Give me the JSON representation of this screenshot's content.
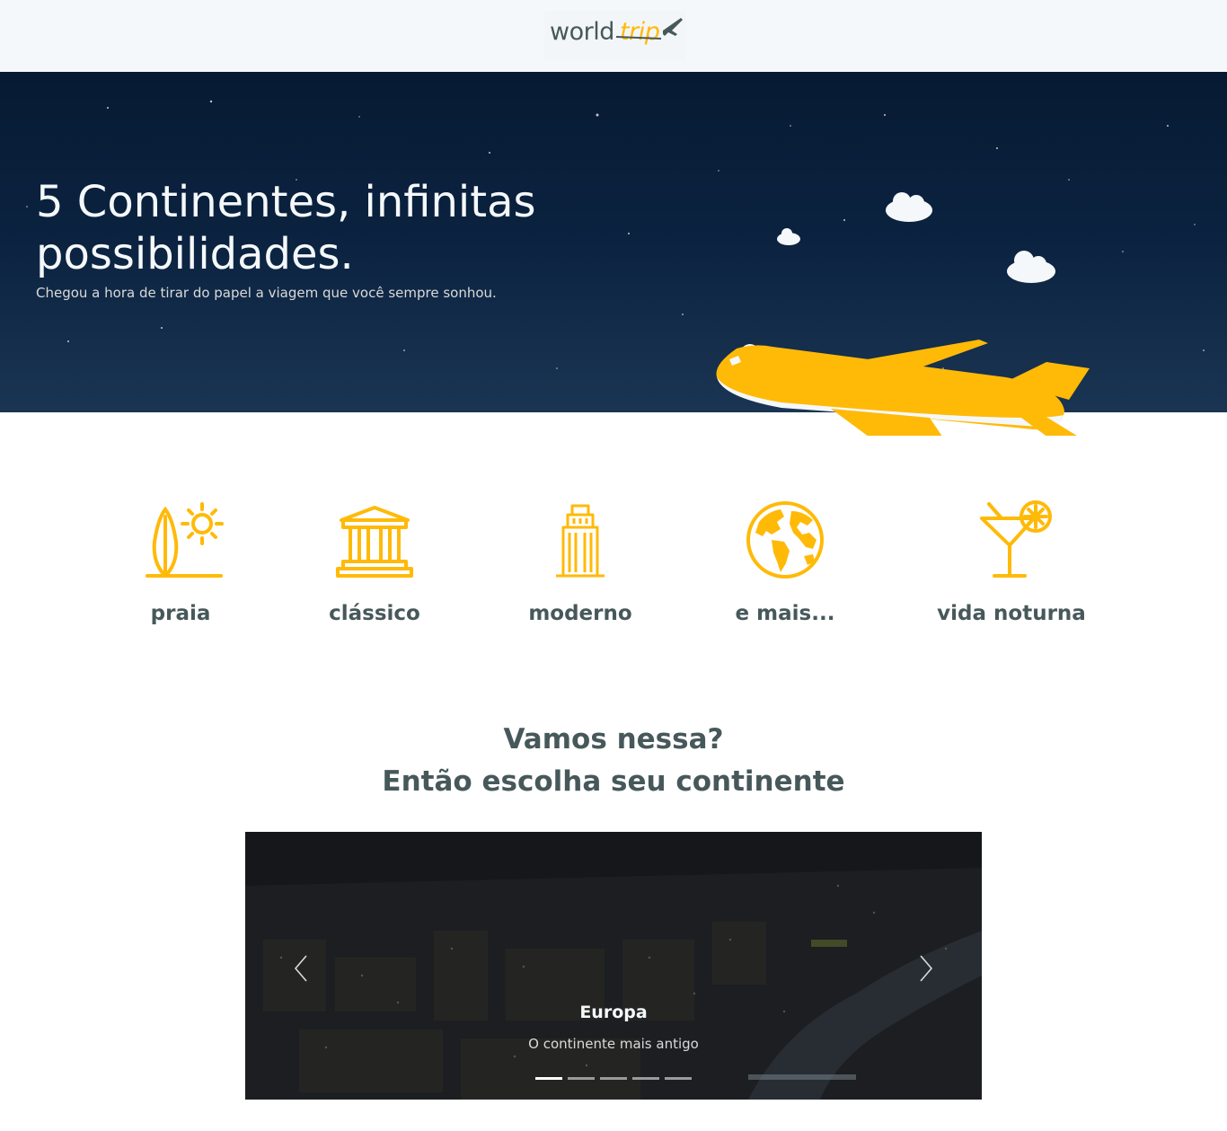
{
  "header": {
    "logo_world": "world",
    "logo_trip": "trip"
  },
  "hero": {
    "title": "5 Continentes, infinitas possibilidades.",
    "subtitle": "Chegou a hora de tirar do papel a viagem que você sempre sonhou."
  },
  "categories": [
    {
      "label": "praia",
      "icon": "surfboard-sun-icon"
    },
    {
      "label": "clássico",
      "icon": "museum-icon"
    },
    {
      "label": "moderno",
      "icon": "skyscraper-icon"
    },
    {
      "label": "e mais...",
      "icon": "globe-icon"
    },
    {
      "label": "vida noturna",
      "icon": "cocktail-icon"
    }
  ],
  "section": {
    "line1": "Vamos nessa?",
    "line2": "Então escolha seu continente"
  },
  "carousel": {
    "title": "Europa",
    "subtitle": "O continente mais antigo",
    "slide_count": 5,
    "active_index": 0
  },
  "colors": {
    "highlight": "#ffba08",
    "dark_text": "#47585b",
    "light": "#f5f8fa"
  }
}
